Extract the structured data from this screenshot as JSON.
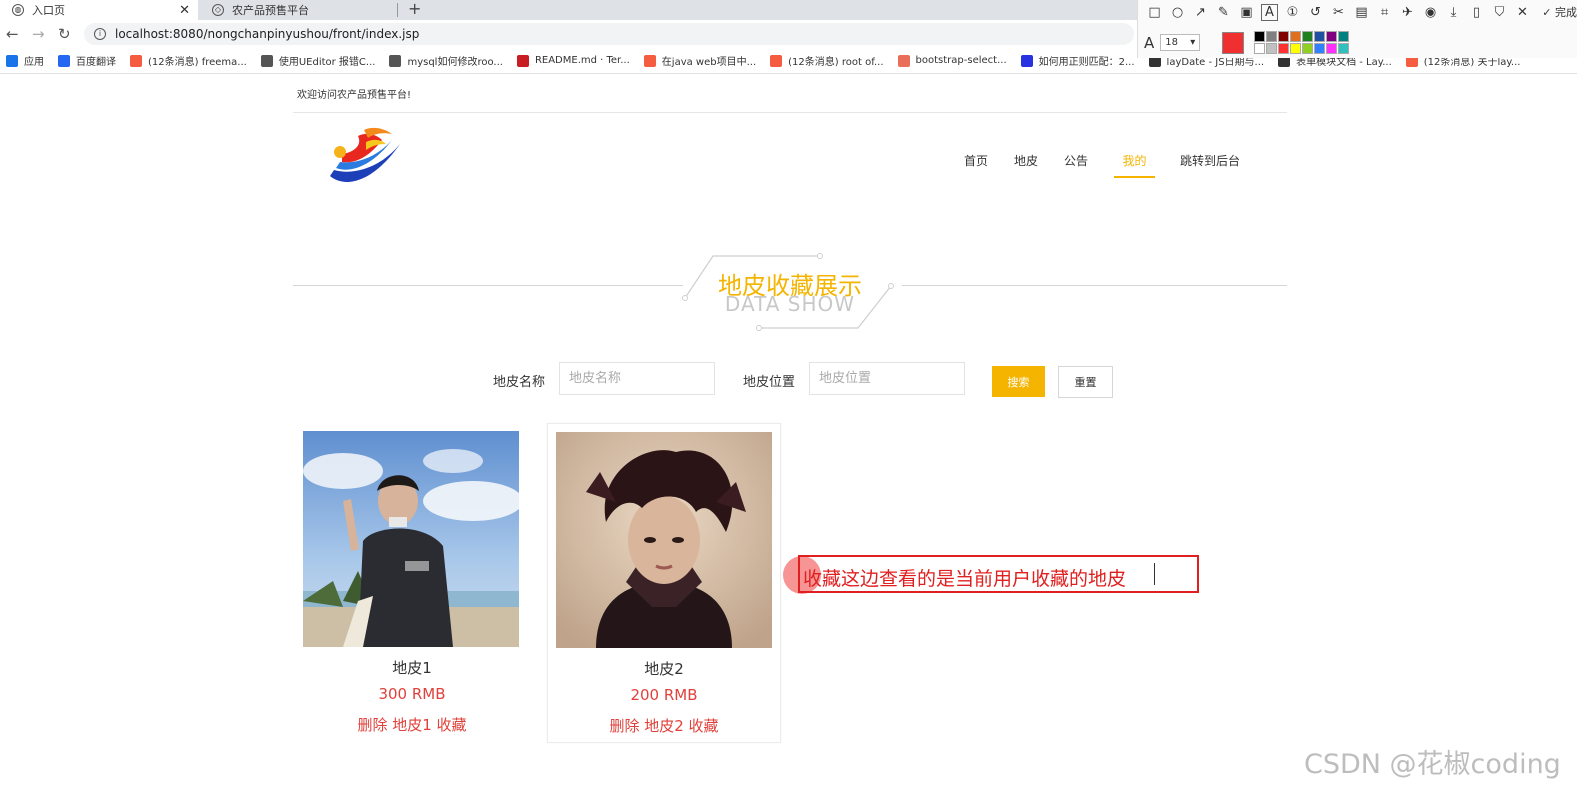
{
  "browser": {
    "tabs": [
      {
        "title": "入口页",
        "active": true
      },
      {
        "title": "农产品预售平台",
        "active": false
      }
    ],
    "url": "localhost:8080/nongchanpinyushou/front/index.jsp",
    "bookmarks": [
      {
        "label": "应用",
        "icon": "apps-grid-icon",
        "color": "#1a73e8"
      },
      {
        "label": "百度翻译",
        "icon": "baidu-translate-icon",
        "color": "#2468f2"
      },
      {
        "label": "(12条消息) freema...",
        "icon": "csdn-icon",
        "color": "#f45d40"
      },
      {
        "label": "使用UEditor 报错C...",
        "icon": "ueditor-icon",
        "color": "#555555"
      },
      {
        "label": "mysql如何修改roo...",
        "icon": "ueditor-icon",
        "color": "#555555"
      },
      {
        "label": "README.md · Ter...",
        "icon": "gitee-icon",
        "color": "#c71d23"
      },
      {
        "label": "在java web项目中...",
        "icon": "csdn-icon",
        "color": "#f45d40"
      },
      {
        "label": "(12条消息) root of...",
        "icon": "csdn-icon",
        "color": "#f45d40"
      },
      {
        "label": "bootstrap-select...",
        "icon": "jianshu-icon",
        "color": "#ea6f5a"
      },
      {
        "label": "如何用正则匹配：2...",
        "icon": "baidu-paw-icon",
        "color": "#2932e1"
      },
      {
        "label": "layDate - JS日期与...",
        "icon": "layui-icon",
        "color": "#333333"
      },
      {
        "label": "表单模块文档 - Lay...",
        "icon": "layui-icon",
        "color": "#333333"
      },
      {
        "label": "(12条消息) 关于lay...",
        "icon": "csdn-icon",
        "color": "#f45d40"
      }
    ]
  },
  "snip_toolbar": {
    "font_size": "18",
    "done_label": "完成",
    "current_color": "#f03030",
    "palette": [
      "#000000",
      "#808080",
      "#800000",
      "#e07020",
      "#208020",
      "#2050a0",
      "#800080",
      "#008080",
      "#ffffff",
      "#c0c0c0",
      "#ff3030",
      "#ffff00",
      "#90d020",
      "#3080ff",
      "#ff30ff",
      "#30c0c0"
    ]
  },
  "page": {
    "welcome": "欢迎访问农产品预售平台!",
    "nav": [
      {
        "label": "首页",
        "active": false
      },
      {
        "label": "地皮",
        "active": false
      },
      {
        "label": "公告",
        "active": false
      },
      {
        "label": "我的",
        "active": true
      },
      {
        "label": "跳转到后台",
        "active": false
      }
    ],
    "section_title_cn": "地皮收藏展示",
    "section_title_en": "DATA SHOW",
    "search": {
      "name_label": "地皮名称",
      "name_placeholder": "地皮名称",
      "location_label": "地皮位置",
      "location_placeholder": "地皮位置",
      "search_button": "搜索",
      "reset_button": "重置"
    },
    "cards": [
      {
        "name": "地皮1",
        "price": "300 RMB",
        "actions": "删除 地皮1 收藏"
      },
      {
        "name": "地皮2",
        "price": "200 RMB",
        "actions": "删除 地皮2 收藏"
      }
    ],
    "accent_color": "#f4b400",
    "price_color": "#e0413a"
  },
  "annotation": {
    "text": "收藏这边查看的是当前用户收藏的地皮"
  },
  "watermark": "CSDN @花椒coding"
}
